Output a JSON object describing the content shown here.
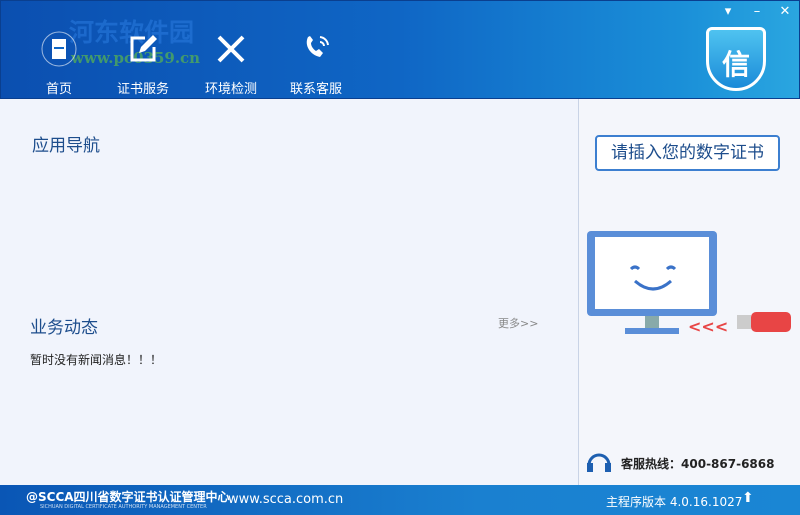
{
  "header": {
    "nav": [
      {
        "label": "首页",
        "icon": "home-icon"
      },
      {
        "label": "证书服务",
        "icon": "edit-icon"
      },
      {
        "label": "环境检测",
        "icon": "tools-icon"
      },
      {
        "label": "联系客服",
        "icon": "phone-icon"
      }
    ],
    "watermark": {
      "title": "河东软件园",
      "url": "www.pc0359.cn"
    },
    "badge": "信"
  },
  "main": {
    "app_nav_title": "应用导航",
    "news_title": "业务动态",
    "more_link": "更多>>",
    "news_empty": "暂时没有新闻消息！！！"
  },
  "side": {
    "insert_button": "请插入您的数字证书",
    "hotline_label": "客服热线：",
    "hotline": "400-867-6868"
  },
  "footer": {
    "logo": "@SCCA四川省数字证书认证管理中心",
    "logo_sub": "SICHUAN DIGITAL CERTIFICATE AUTHORITY MANAGEMENT CENTER",
    "website": "www.scca.com.cn",
    "version_label": "主程序版本",
    "version": "4.0.16.1027"
  }
}
